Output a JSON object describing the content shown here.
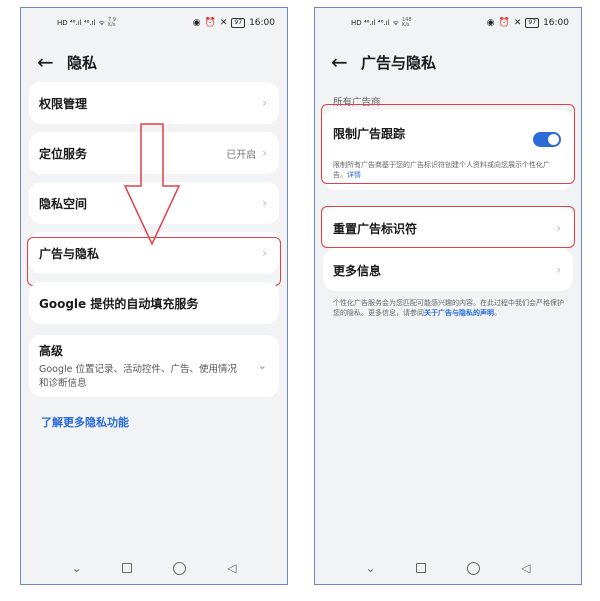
{
  "status_left": {
    "carrier_icons": "HD ⁴⁶.ıl ⁴⁶.ıl",
    "speed_value_left": "7.9",
    "speed_value_right": "148",
    "speed_unit": "K/s"
  },
  "status_right": {
    "time": "16:00",
    "battery": "97"
  },
  "left": {
    "title": "隐私",
    "items": [
      {
        "label": "权限管理"
      },
      {
        "label": "定位服务",
        "value": "已开启"
      },
      {
        "label": "隐私空间"
      },
      {
        "label": "广告与隐私"
      },
      {
        "label": "Google 提供的自动填充服务"
      }
    ],
    "advanced": {
      "label": "高级",
      "sub": "Google 位置记录、活动控件、广告、使用情况和诊断信息"
    },
    "learn_more": "了解更多隐私功能"
  },
  "right": {
    "title": "广告与隐私",
    "section_label": "所有广告商",
    "limit_tracking": {
      "label": "限制广告跟踪",
      "desc": "限制所有广告商基于您的广告标识符创建个人资料或向您展示个性化广告。",
      "desc_link": "详情"
    },
    "reset_id": "重置广告标识符",
    "more_info": "更多信息",
    "footnote": "个性化广告服务会为您匹配可能感兴趣的内容。在此过程中我们会严格保护您的隐私。更多信息，请参阅",
    "footnote_link": "关于广告与隐私的声明",
    "footnote_end": "。"
  },
  "colors": {
    "accent": "#2a6bd8",
    "highlight": "#e0404a",
    "background": "#f1f3f5"
  },
  "icons": [
    "back-arrow-icon",
    "chevron-right-icon",
    "chevron-down-icon",
    "toggle-switch",
    "nav-back-icon",
    "nav-home-icon",
    "nav-recents-icon",
    "nav-down-icon"
  ]
}
